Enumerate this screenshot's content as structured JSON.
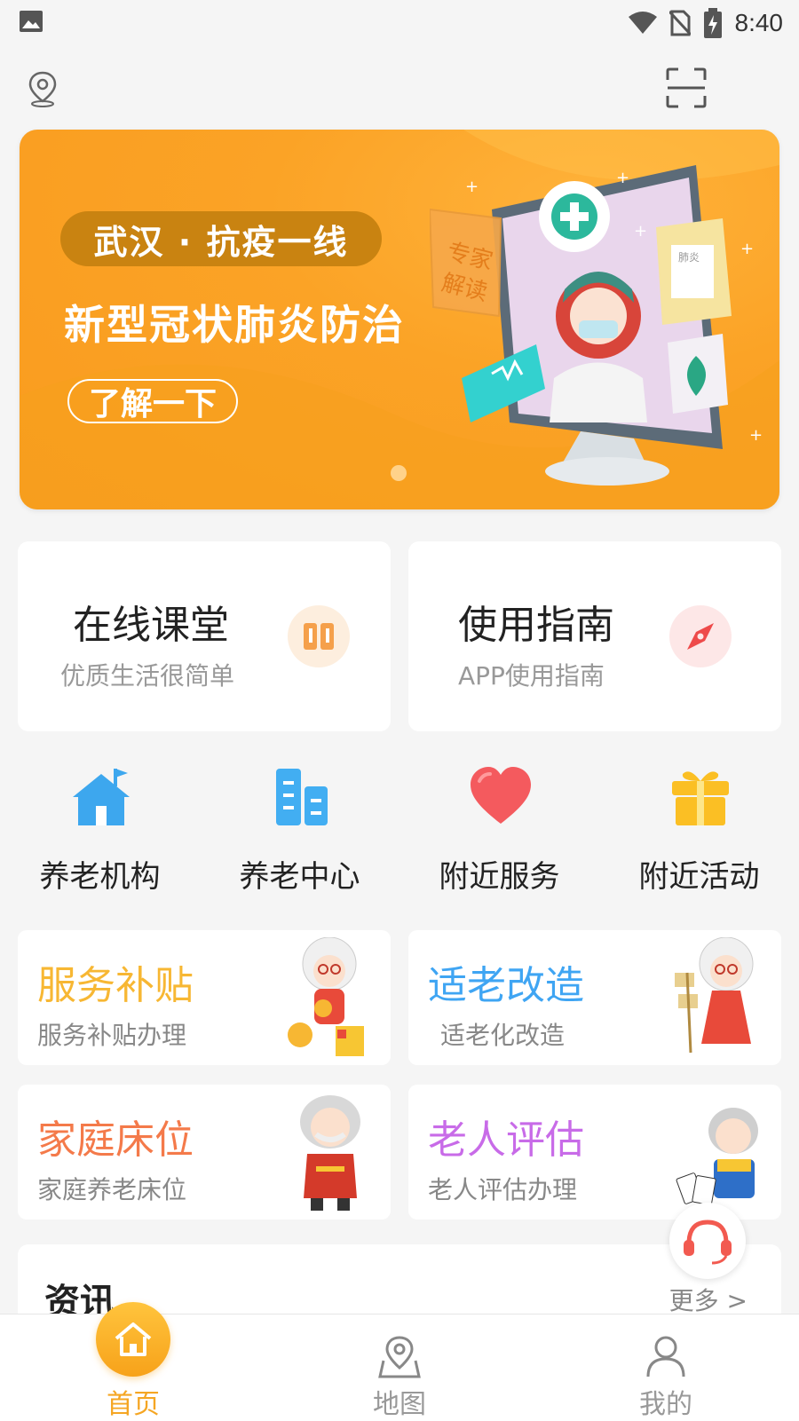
{
  "status_bar": {
    "time": "8:40"
  },
  "banner": {
    "pill": "武汉 · 抗疫一线",
    "title": "新型冠状肺炎防治",
    "button": "了解一下",
    "art_label_1": "专家",
    "art_label_2": "解读",
    "art_doc_label": "肺炎"
  },
  "features": [
    {
      "title": "在线课堂",
      "subtitle": "优质生活很简单",
      "icon": "book-icon",
      "icon_bg": "#fdeede",
      "icon_color": "#f5a04b"
    },
    {
      "title": "使用指南",
      "subtitle": "APP使用指南",
      "icon": "compass-icon",
      "icon_bg": "#fde7e7",
      "icon_color": "#ee4a4a"
    }
  ],
  "quick_nav": [
    {
      "label": "养老机构",
      "icon": "house-flag-icon"
    },
    {
      "label": "养老中心",
      "icon": "buildings-icon"
    },
    {
      "label": "附近服务",
      "icon": "heart-icon"
    },
    {
      "label": "附近活动",
      "icon": "gift-icon"
    }
  ],
  "services": [
    {
      "title": "服务补贴",
      "subtitle": "服务补贴办理",
      "color": "#f7b733"
    },
    {
      "title": "适老改造",
      "subtitle": "适老化改造",
      "color": "#3fa5f3"
    },
    {
      "title": "家庭床位",
      "subtitle": "家庭养老床位",
      "color": "#f47a4a"
    },
    {
      "title": "老人评估",
      "subtitle": "老人评估办理",
      "color": "#c86be8"
    }
  ],
  "news": {
    "title": "资讯",
    "more": "更多 >"
  },
  "tabs": [
    {
      "label": "首页",
      "active": true
    },
    {
      "label": "地图",
      "active": false
    },
    {
      "label": "我的",
      "active": false
    }
  ],
  "colors": {
    "accent": "#f5a623",
    "background": "#f5f5f5"
  }
}
